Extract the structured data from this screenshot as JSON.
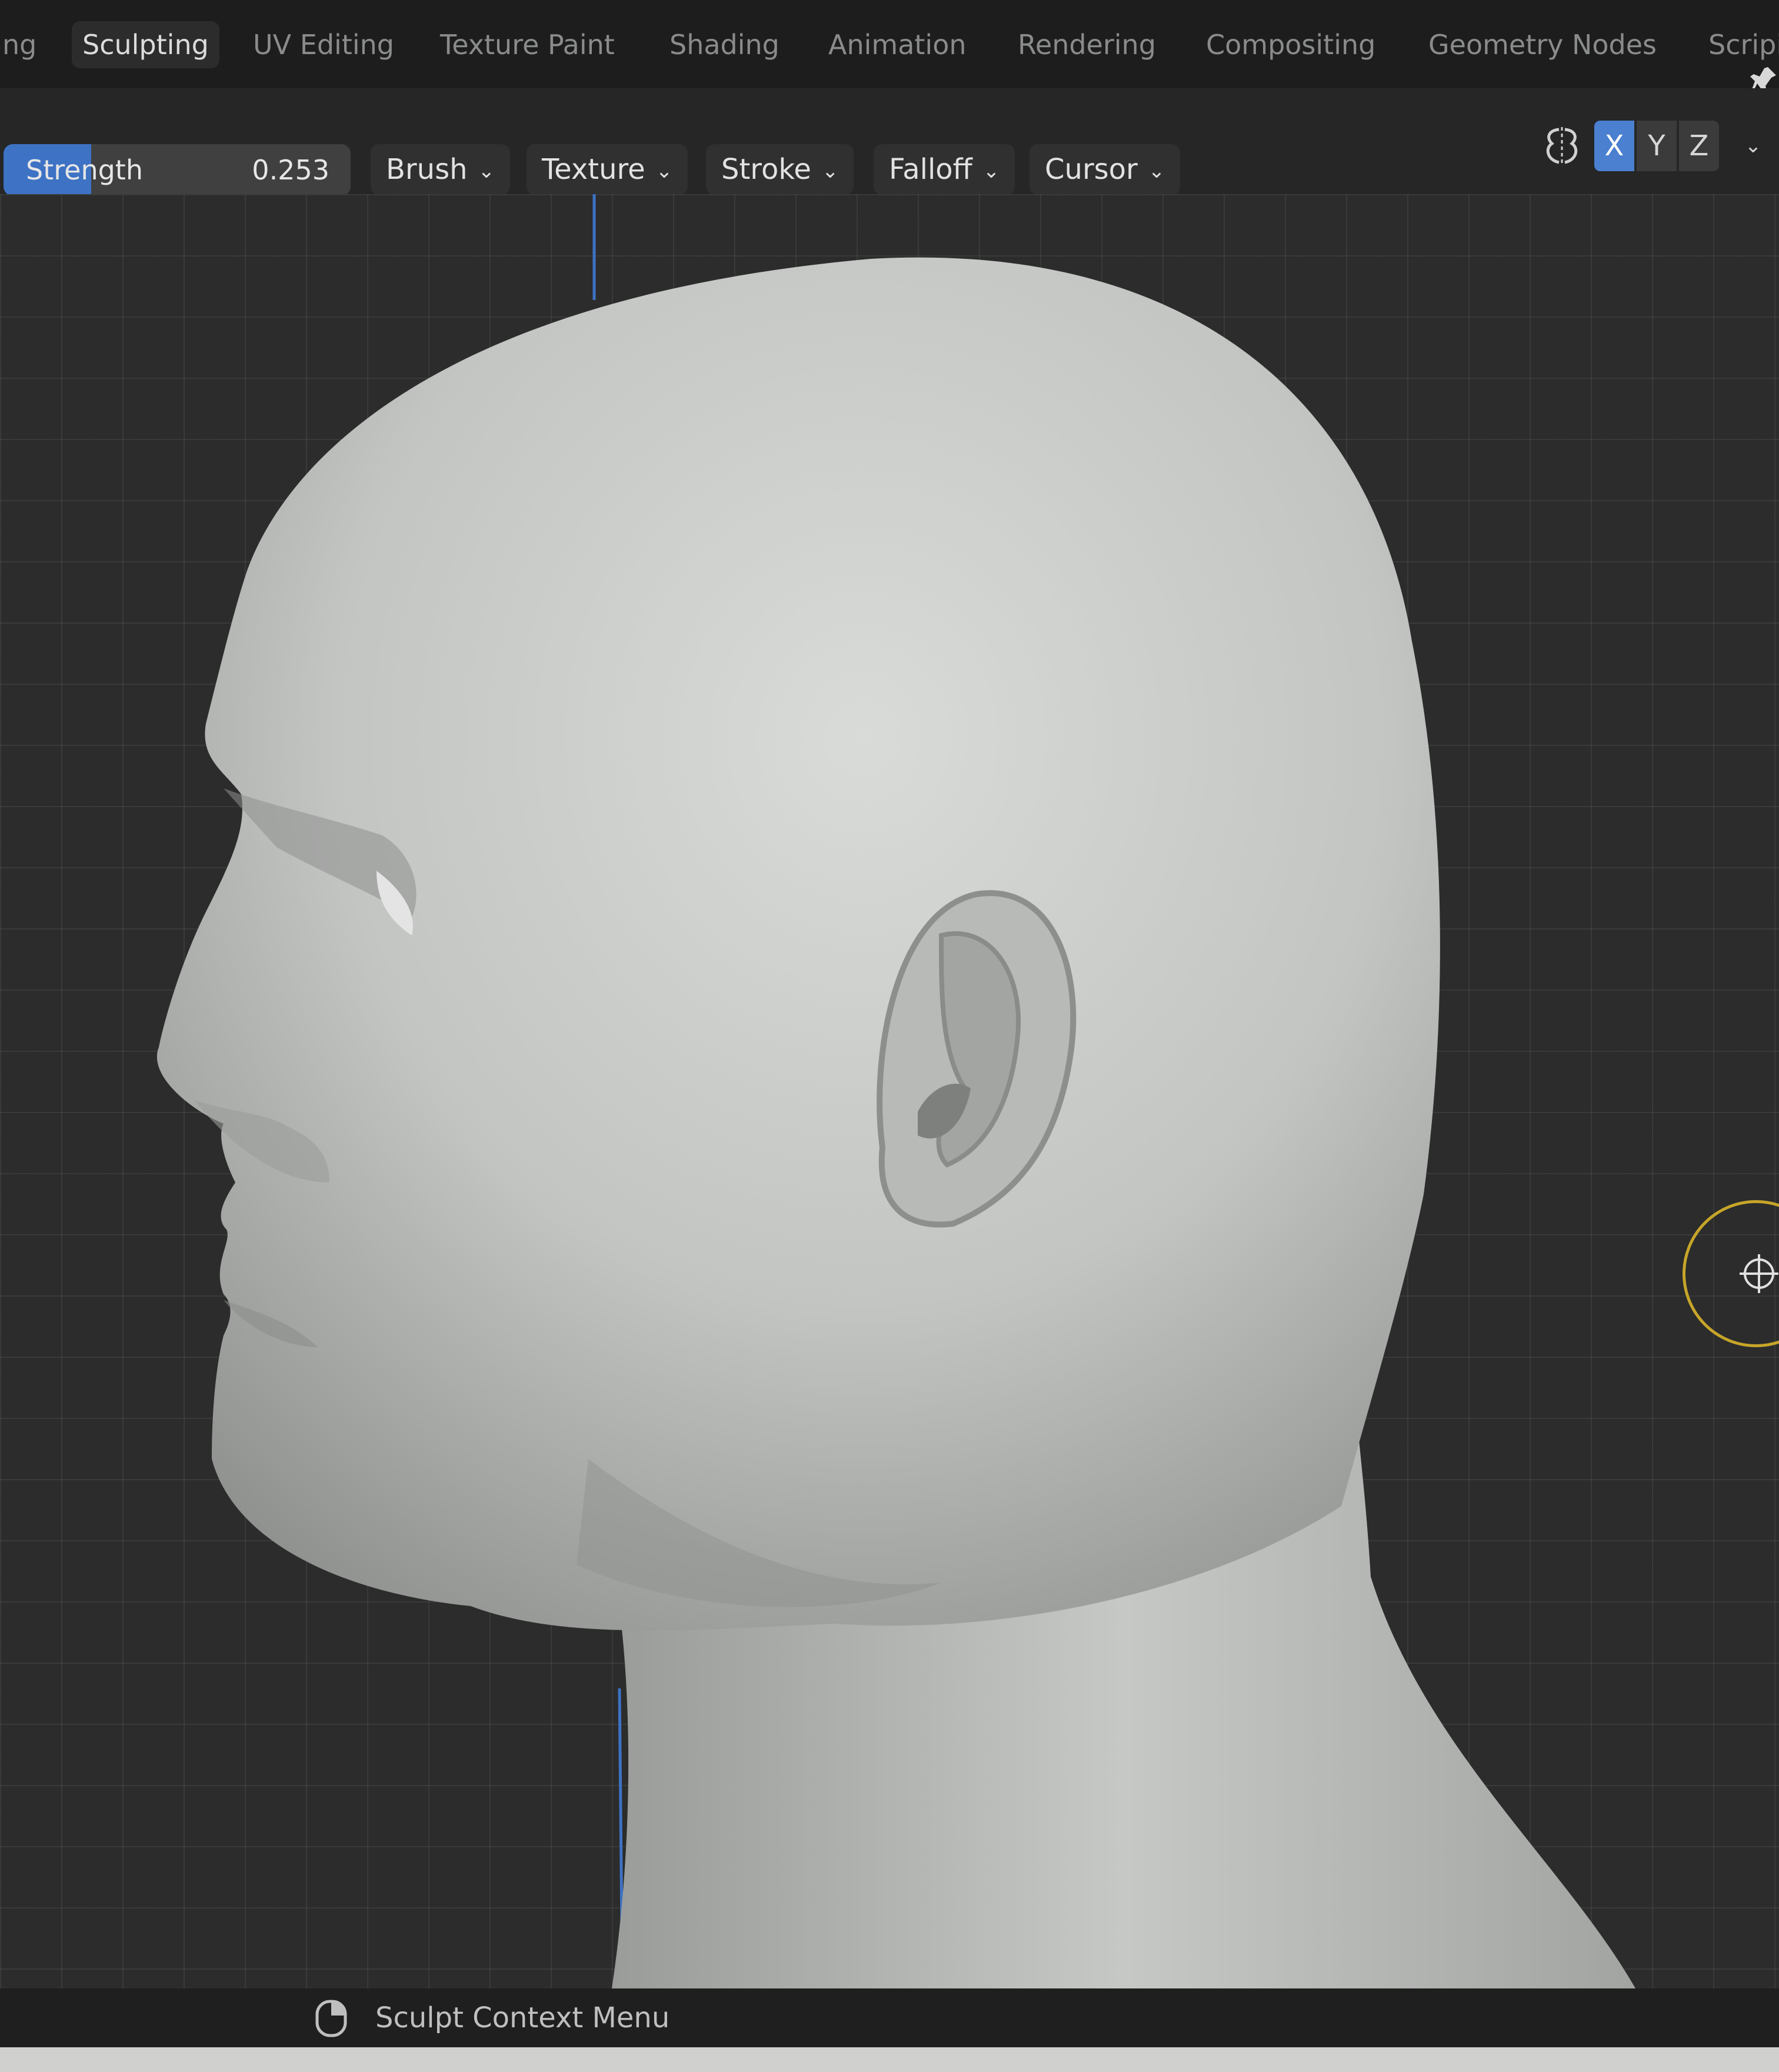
{
  "workspace_tabs": [
    {
      "label": "ng",
      "active": false
    },
    {
      "label": "Sculpting",
      "active": true
    },
    {
      "label": "UV Editing",
      "active": false
    },
    {
      "label": "Texture Paint",
      "active": false
    },
    {
      "label": "Shading",
      "active": false
    },
    {
      "label": "Animation",
      "active": false
    },
    {
      "label": "Rendering",
      "active": false
    },
    {
      "label": "Compositing",
      "active": false
    },
    {
      "label": "Geometry Nodes",
      "active": false
    },
    {
      "label": "Scripi",
      "active": false
    }
  ],
  "tool_header": {
    "strength": {
      "label": "Strength",
      "value": "0.253",
      "fraction": 0.253
    },
    "menus": [
      {
        "label": "Brush"
      },
      {
        "label": "Texture"
      },
      {
        "label": "Stroke"
      },
      {
        "label": "Falloff"
      },
      {
        "label": "Cursor"
      }
    ],
    "symmetry_icon": "mirror-symmetry-icon",
    "axes": [
      {
        "label": "X",
        "active": true
      },
      {
        "label": "Y",
        "active": false
      },
      {
        "label": "Z",
        "active": false
      }
    ],
    "axis_dropdown_icon": "chevron-down-icon"
  },
  "viewport": {
    "object": "sculpted-head-mesh",
    "cursor_icon": "3d-cursor-icon"
  },
  "status_bar": {
    "mouse_icon": "mouse-right-click-icon",
    "text": "Sculpt Context Menu"
  },
  "colors": {
    "accent": "#4a80cf",
    "strength_fill": "#3d72c4",
    "gizmo": "#c7a529",
    "mesh": "#c9cbc9"
  }
}
